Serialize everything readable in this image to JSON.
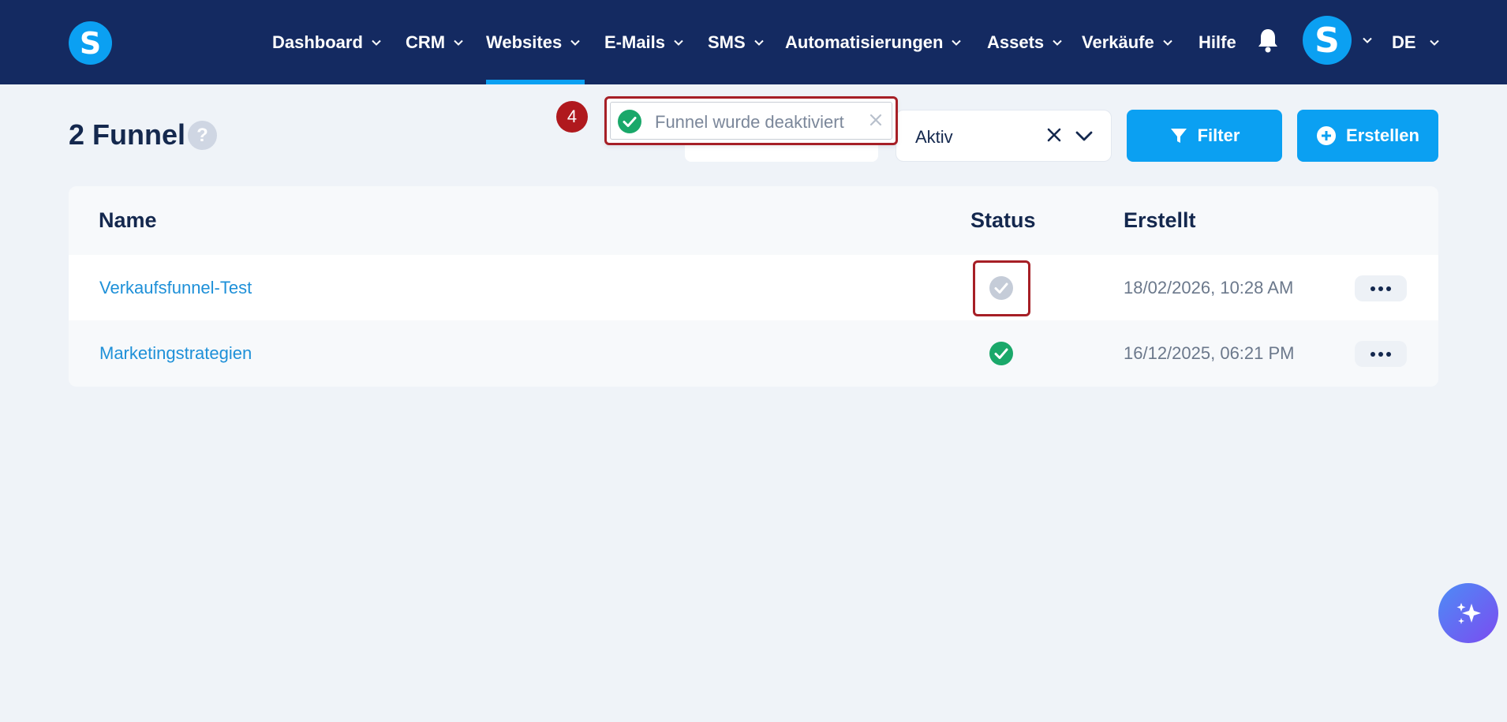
{
  "header": {
    "logo_letter": "S",
    "nav": [
      {
        "label": "Dashboard",
        "has_dropdown": true
      },
      {
        "label": "CRM",
        "has_dropdown": true
      },
      {
        "label": "Websites",
        "has_dropdown": true,
        "active": true
      },
      {
        "label": "E-Mails",
        "has_dropdown": true
      },
      {
        "label": "SMS",
        "has_dropdown": true
      },
      {
        "label": "Automatisierungen",
        "has_dropdown": true
      },
      {
        "label": "Assets",
        "has_dropdown": true
      },
      {
        "label": "Verkäufe",
        "has_dropdown": true
      },
      {
        "label": "Hilfe",
        "has_dropdown": false
      }
    ],
    "notifications_icon": "bell-icon",
    "avatar_letter": "S",
    "language": "DE"
  },
  "page": {
    "title": "2 Funnel",
    "help_symbol": "?"
  },
  "toolbar": {
    "status_select_value": "Aktiv",
    "filter_label": "Filter",
    "create_label": "Erstellen"
  },
  "toast": {
    "message": "Funnel wurde deaktiviert",
    "step_number": "4"
  },
  "table": {
    "columns": [
      "Name",
      "Status",
      "Erstellt"
    ],
    "rows": [
      {
        "name": "Verkaufsfunnel-Test",
        "status": "inactive",
        "created": "18/02/2026, 10:28 AM"
      },
      {
        "name": "Marketingstrategien",
        "status": "active",
        "created": "16/12/2025, 06:21 PM"
      }
    ]
  },
  "colors": {
    "nav_bg": "#142a61",
    "accent": "#0ba0f2",
    "status_active": "#1aa86a",
    "status_inactive": "#c5ccd8",
    "highlight": "#a61f26"
  }
}
